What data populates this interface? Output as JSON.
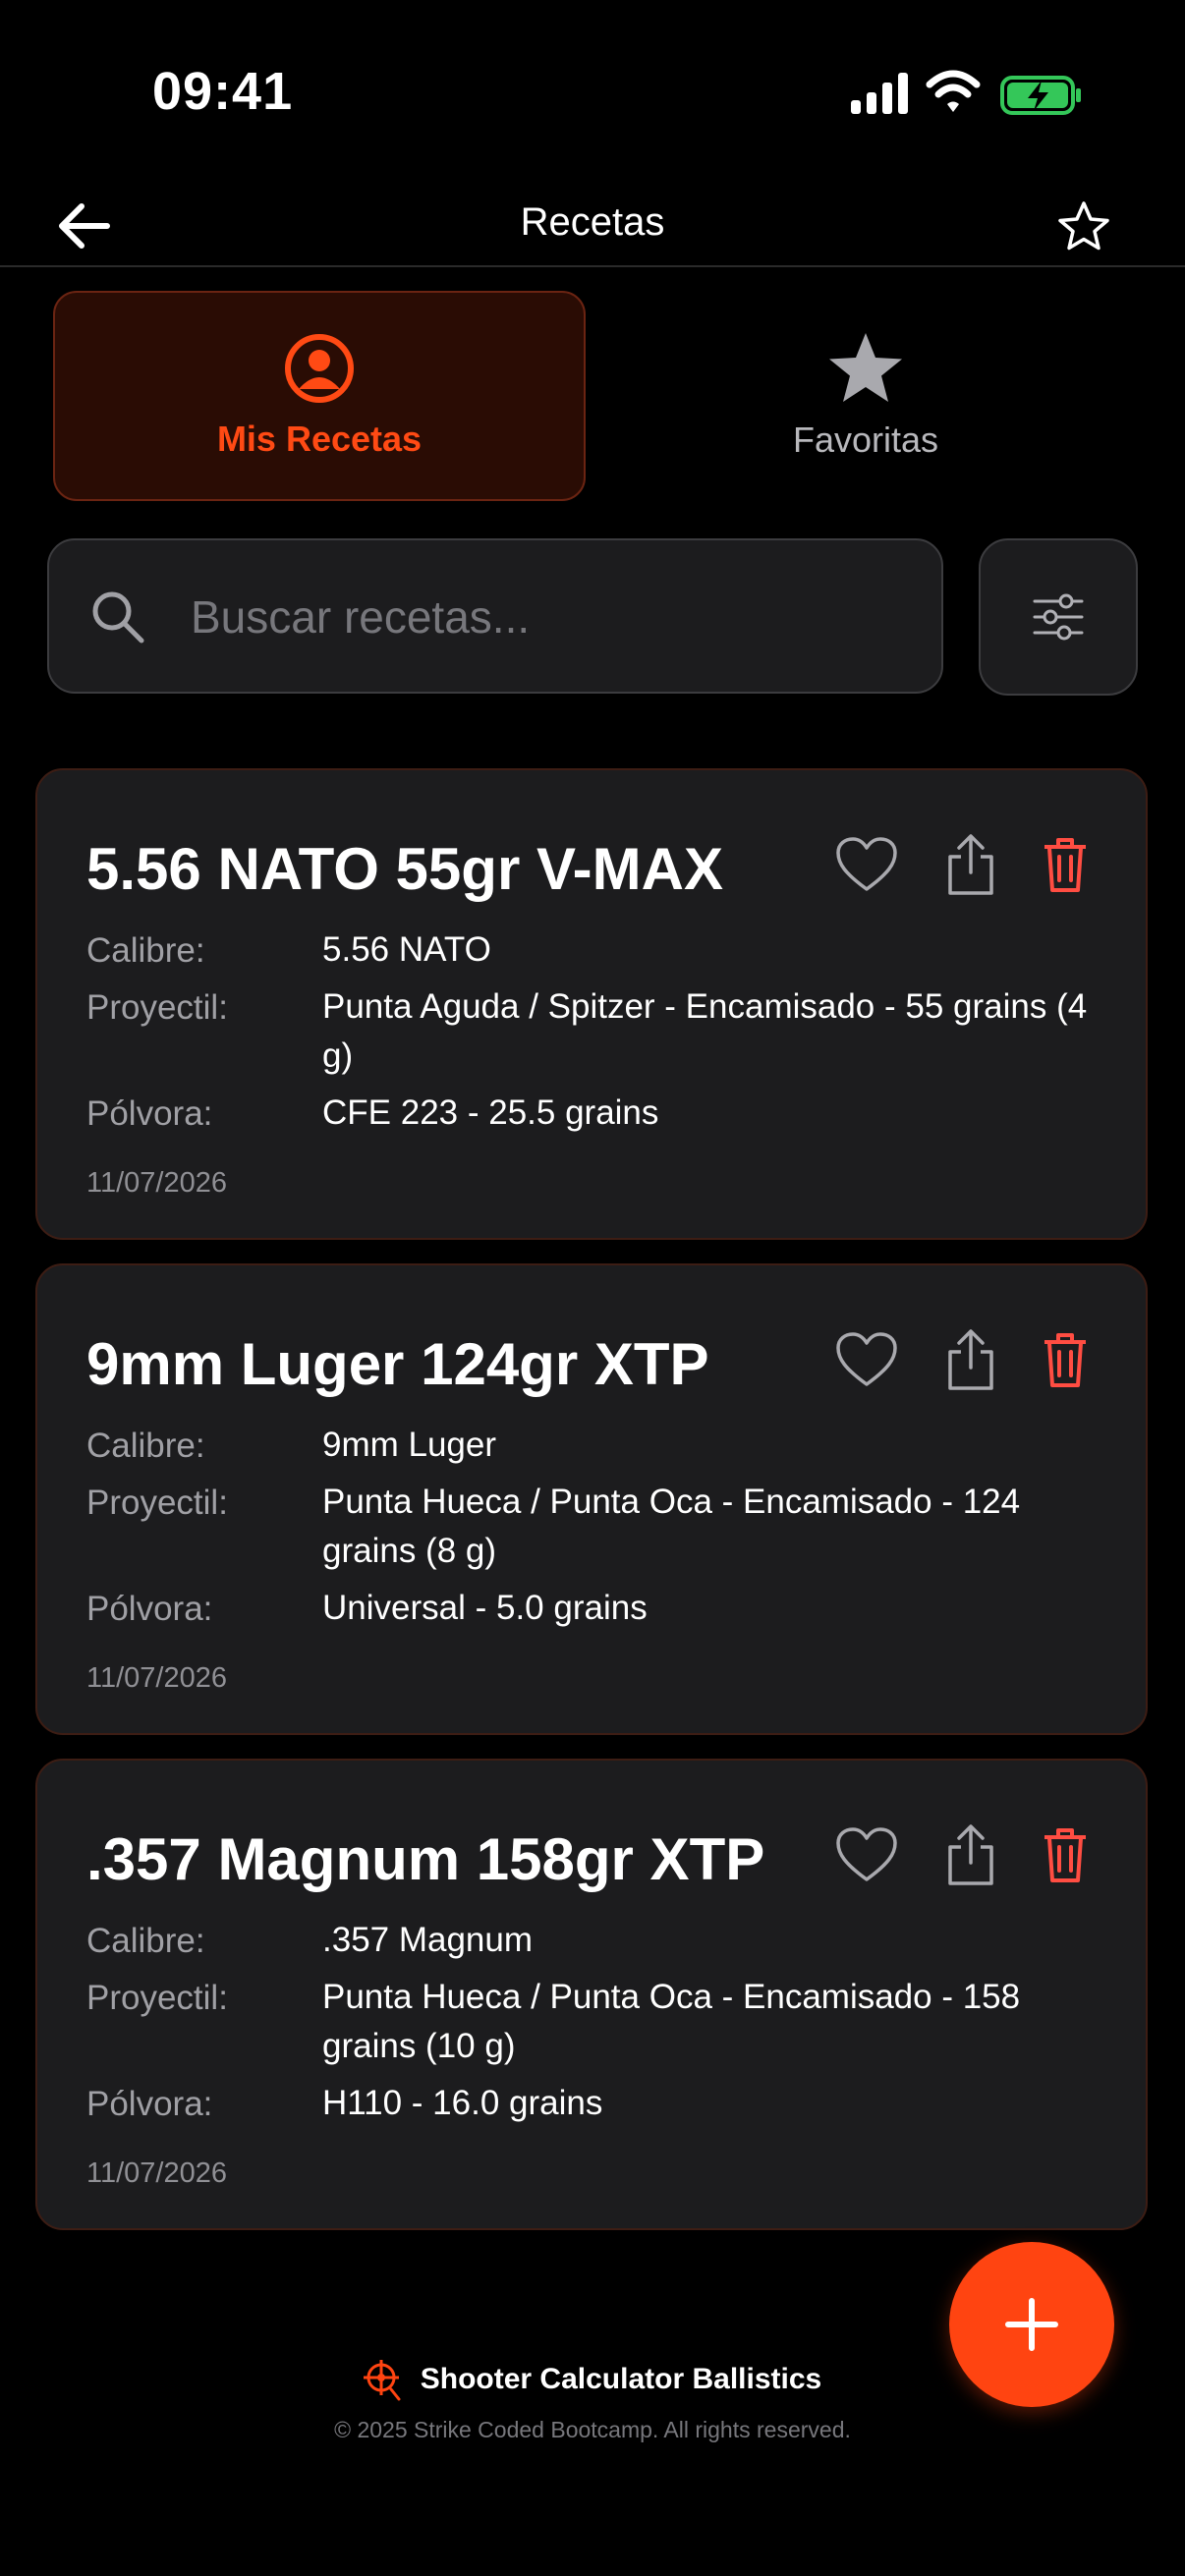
{
  "status_bar": {
    "time": "09:41"
  },
  "nav": {
    "title": "Recetas"
  },
  "tabs": [
    {
      "label": "Mis Recetas",
      "active": true
    },
    {
      "label": "Favoritas",
      "active": false
    }
  ],
  "search": {
    "placeholder": "Buscar recetas...",
    "value": ""
  },
  "labels": {
    "calibre": "Calibre:",
    "proyectil": "Proyectil:",
    "polvora": "Pólvora:"
  },
  "recipes": [
    {
      "title": "5.56 NATO 55gr V-MAX",
      "calibre": "5.56 NATO",
      "proyectil": "Punta Aguda / Spitzer - Encamisado - 55 grains (4 g)",
      "polvora": "CFE 223 - 25.5 grains",
      "date": "11/07/2026"
    },
    {
      "title": "9mm Luger 124gr XTP",
      "calibre": "9mm Luger",
      "proyectil": "Punta Hueca / Punta Oca - Encamisado - 124 grains (8 g)",
      "polvora": "Universal - 5.0 grains",
      "date": "11/07/2026"
    },
    {
      "title": ".357 Magnum 158gr XTP",
      "calibre": ".357 Magnum",
      "proyectil": "Punta Hueca / Punta Oca - Encamisado - 158 grains (10 g)",
      "polvora": "H110 - 16.0 grains",
      "date": "11/07/2026"
    }
  ],
  "footer": {
    "brand": "Shooter Calculator Ballistics",
    "copyright": "© 2025 Strike Coded Bootcamp. All rights reserved."
  },
  "colors": {
    "accent": "#ff4411",
    "background": "#000000",
    "card": "#1c1c1e",
    "delete": "#ff4d42",
    "battery": "#34c759"
  },
  "icons": {
    "back": "arrow-left-icon",
    "favorite_nav": "star-outline-icon",
    "tab_mine": "user-circle-icon",
    "tab_fav": "star-filled-icon",
    "search": "search-icon",
    "filter": "sliders-icon",
    "fav": "heart-icon",
    "share": "share-icon",
    "delete": "trash-icon",
    "add": "plus-icon",
    "brand": "crosshair-logo-icon"
  }
}
